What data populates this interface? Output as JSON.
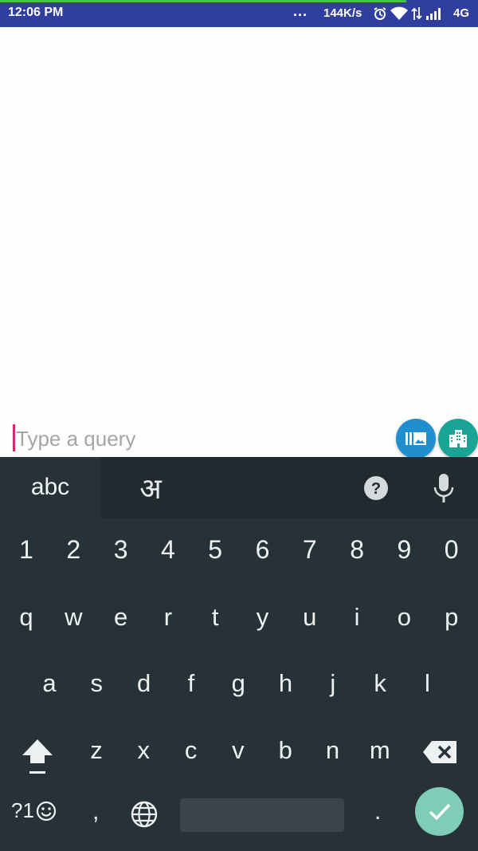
{
  "status_bar": {
    "time": "12:06 PM",
    "dots": "...",
    "speed": "144K/s",
    "network": "4G",
    "icons": [
      "alarm-icon",
      "wifi-icon",
      "data-arrows-icon",
      "signal-icon"
    ],
    "background": "#303f9f"
  },
  "query": {
    "placeholder": "Type a query",
    "value": "",
    "accent": "#d8286c"
  },
  "fabs": [
    {
      "name": "gallery",
      "icon": "gallery-icon",
      "color": "#1f8fcf"
    },
    {
      "name": "building",
      "icon": "building-icon",
      "color": "#1aa495"
    }
  ],
  "keyboard": {
    "tab_abc": "abc",
    "tab_hindi": "अ",
    "numbers": [
      "1",
      "2",
      "3",
      "4",
      "5",
      "6",
      "7",
      "8",
      "9",
      "0"
    ],
    "row1": [
      "q",
      "w",
      "e",
      "r",
      "t",
      "y",
      "u",
      "i",
      "o",
      "p"
    ],
    "row2": [
      "a",
      "s",
      "d",
      "f",
      "g",
      "h",
      "j",
      "k",
      "l"
    ],
    "row3": [
      "z",
      "x",
      "c",
      "v",
      "b",
      "n",
      "m"
    ],
    "symbols_label": "?1",
    "comma": ",",
    "period": ".",
    "done_color": "#7fcdb6"
  }
}
